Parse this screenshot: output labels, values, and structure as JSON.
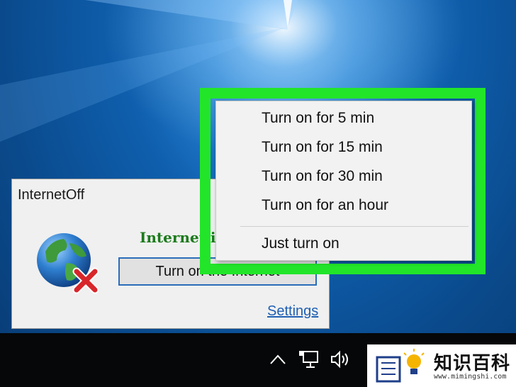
{
  "window": {
    "title": "InternetOff",
    "status_text": "Internet is",
    "main_button_label": "Turn on the Internet",
    "settings_link": "Settings"
  },
  "context_menu": {
    "items": [
      {
        "label": "Turn on for 5 min"
      },
      {
        "label": "Turn on for 15 min"
      },
      {
        "label": "Turn on for 30 min"
      },
      {
        "label": "Turn on for an hour"
      },
      {
        "label": "Just turn on"
      }
    ]
  },
  "tray": {
    "icons": [
      "chevron-up-icon",
      "network-icon",
      "volume-icon"
    ]
  },
  "watermark": {
    "title": "知识百科",
    "url": "www.mimingshi.com"
  },
  "colors": {
    "highlight": "#22e52a",
    "status_green": "#1c7a1c",
    "link_blue": "#1f5fb4",
    "button_border": "#2a6dbb"
  }
}
